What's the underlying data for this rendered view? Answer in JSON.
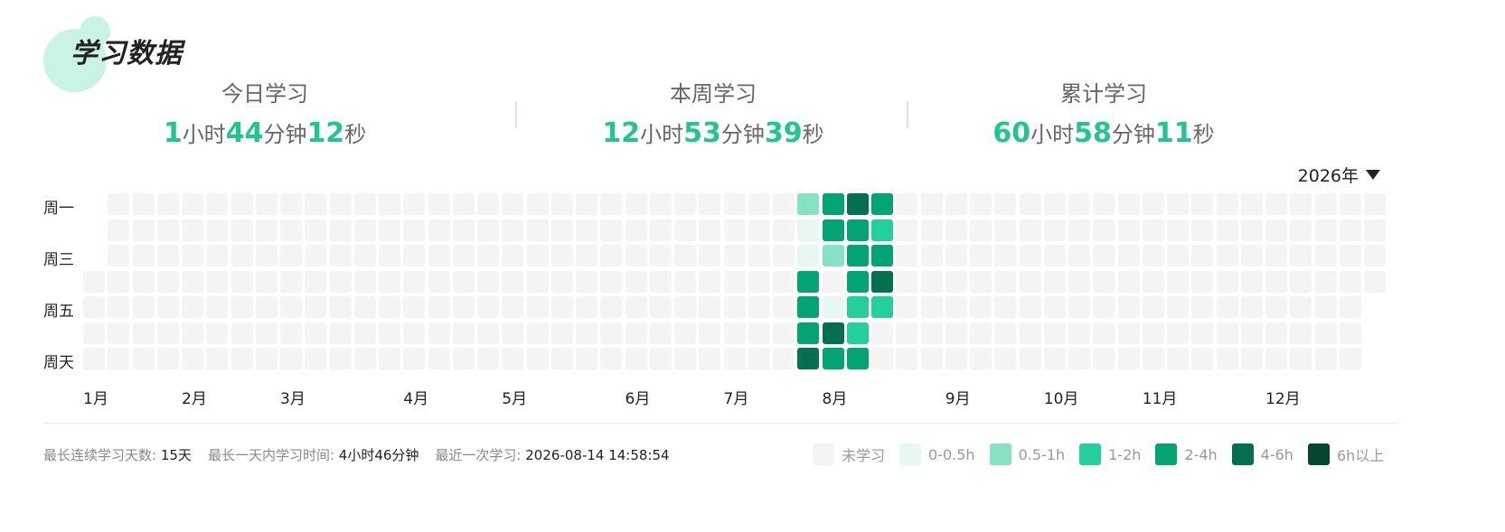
{
  "header": {
    "title": "学习数据"
  },
  "stats": {
    "today": {
      "label": "今日学习",
      "hours": "1",
      "hours_unit": "小时",
      "minutes": "44",
      "minutes_unit": "分钟",
      "seconds": "12",
      "seconds_unit": "秒"
    },
    "week": {
      "label": "本周学习",
      "hours": "12",
      "hours_unit": "小时",
      "minutes": "53",
      "minutes_unit": "分钟",
      "seconds": "39",
      "seconds_unit": "秒"
    },
    "total": {
      "label": "累计学习",
      "hours": "60",
      "hours_unit": "小时",
      "minutes": "58",
      "minutes_unit": "分钟",
      "seconds": "11",
      "seconds_unit": "秒"
    }
  },
  "year_select": {
    "value": "2026年"
  },
  "heatmap": {
    "day_labels": [
      "周一",
      "",
      "周三",
      "",
      "周五",
      "",
      "周天"
    ],
    "month_labels": [
      "1月",
      "2月",
      "3月",
      "4月",
      "5月",
      "6月",
      "7月",
      "8月",
      "9月",
      "10月",
      "11月",
      "12月"
    ],
    "week_columns": 53,
    "first_day_row": 3,
    "total_days": 365,
    "active_cells": [
      {
        "date": "2026-07-20",
        "level": 2
      },
      {
        "date": "2026-07-21",
        "level": 1
      },
      {
        "date": "2026-07-22",
        "level": 1
      },
      {
        "date": "2026-07-23",
        "level": 4
      },
      {
        "date": "2026-07-24",
        "level": 4
      },
      {
        "date": "2026-07-25",
        "level": 4
      },
      {
        "date": "2026-07-26",
        "level": 5
      },
      {
        "date": "2026-07-27",
        "level": 4
      },
      {
        "date": "2026-07-28",
        "level": 4
      },
      {
        "date": "2026-07-29",
        "level": 2
      },
      {
        "date": "2026-07-31",
        "level": 1
      },
      {
        "date": "2026-08-01",
        "level": 5
      },
      {
        "date": "2026-08-02",
        "level": 4
      },
      {
        "date": "2026-08-03",
        "level": 5
      },
      {
        "date": "2026-08-04",
        "level": 4
      },
      {
        "date": "2026-08-05",
        "level": 4
      },
      {
        "date": "2026-08-06",
        "level": 4
      },
      {
        "date": "2026-08-07",
        "level": 3
      },
      {
        "date": "2026-08-08",
        "level": 3
      },
      {
        "date": "2026-08-09",
        "level": 4
      },
      {
        "date": "2026-08-10",
        "level": 4
      },
      {
        "date": "2026-08-11",
        "level": 3
      },
      {
        "date": "2026-08-12",
        "level": 4
      },
      {
        "date": "2026-08-13",
        "level": 5
      },
      {
        "date": "2026-08-14",
        "level": 3
      }
    ]
  },
  "legend": {
    "items": [
      {
        "label": "未学习",
        "color": "#f4f4f4"
      },
      {
        "label": "0-0.5h",
        "color": "#e6f8f1"
      },
      {
        "label": "0.5-1h",
        "color": "#86e2c4"
      },
      {
        "label": "1-2h",
        "color": "#21d09b"
      },
      {
        "label": "2-4h",
        "color": "#03a474"
      },
      {
        "label": "4-6h",
        "color": "#03714f"
      },
      {
        "label": "6h以上",
        "color": "#034733"
      }
    ]
  },
  "footer": {
    "streak_label": "最长连续学习天数:",
    "streak_value": "15天",
    "max_day_label": "最长一天内学习时间:",
    "max_day_value": "4小时46分钟",
    "last_label": "最近一次学习:",
    "last_value": "2026-08-14 14:58:54"
  },
  "colors": {
    "accent": "#1fc78f",
    "empty_cell": "#f4f4f4"
  }
}
